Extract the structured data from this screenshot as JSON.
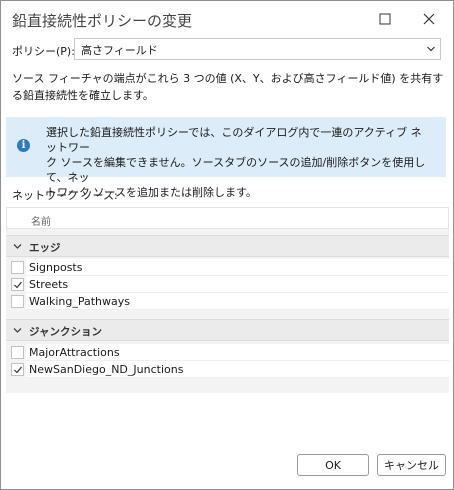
{
  "dialog": {
    "title": "鉛直接続性ポリシーの変更"
  },
  "policy": {
    "label": "ポリシー(P):",
    "selected": "高さフィールド"
  },
  "description": "ソース フィーチャの端点がこれら 3 つの値 (X、Y、および高さフィールド値) を共有する鉛直接続性を確立します。",
  "info": {
    "icon": "info-icon",
    "line1": "選択した鉛直接続性ポリシーでは、このダイアログ内で一連のアクティブ ネットワー",
    "line2": "ク ソースを編集できません。ソースタブのソースの追加/削除ボタンを使用して、ネッ",
    "line3": "トワーク ソースを追加または削除します。"
  },
  "sources": {
    "label": "ネットワーク ソース:",
    "column_name": "名前",
    "groups": [
      {
        "label": "エッジ",
        "items": [
          {
            "label": "Signposts",
            "checked": false
          },
          {
            "label": "Streets",
            "checked": true
          },
          {
            "label": "Walking_Pathways",
            "checked": false
          }
        ]
      },
      {
        "label": "ジャンクション",
        "items": [
          {
            "label": "MajorAttractions",
            "checked": false
          },
          {
            "label": "NewSanDiego_ND_Junctions",
            "checked": true
          }
        ]
      }
    ]
  },
  "buttons": {
    "ok": "OK",
    "cancel": "キャンセル"
  },
  "colors": {
    "info_background": "#dcecf8",
    "info_icon": "#2b7bc2"
  }
}
